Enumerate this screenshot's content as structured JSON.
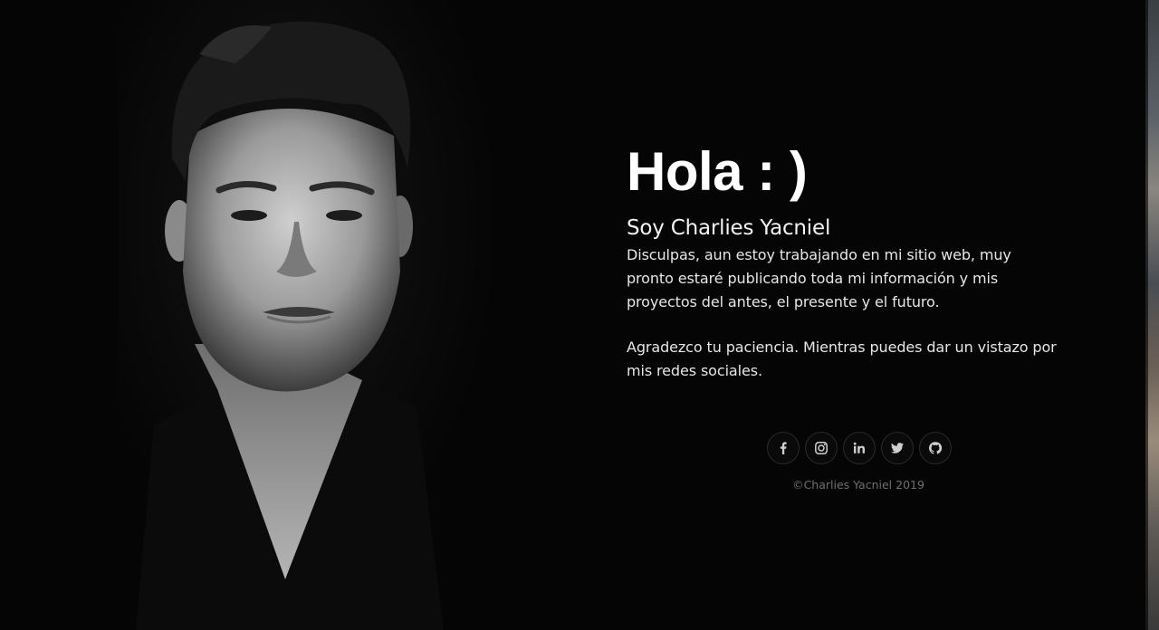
{
  "hero": {
    "greeting": "Hola : )",
    "name": "Soy Charlies Yacniel",
    "paragraph_1": "Disculpas, aun estoy trabajando en mi sitio web, muy pronto estaré publicando toda mi información y mis proyectos del antes, el presente y el futuro.",
    "paragraph_2": "Agradezco tu paciencia. Mientras puedes dar un vistazo por mis redes sociales."
  },
  "social": [
    {
      "icon": "facebook-icon"
    },
    {
      "icon": "instagram-icon"
    },
    {
      "icon": "linkedin-icon"
    },
    {
      "icon": "twitter-icon"
    },
    {
      "icon": "github-icon"
    }
  ],
  "footer": {
    "copyright": "©Charlies Yacniel 2019"
  },
  "colors": {
    "background": "#050505",
    "text": "#ffffff",
    "muted": "#6f6f6f"
  }
}
